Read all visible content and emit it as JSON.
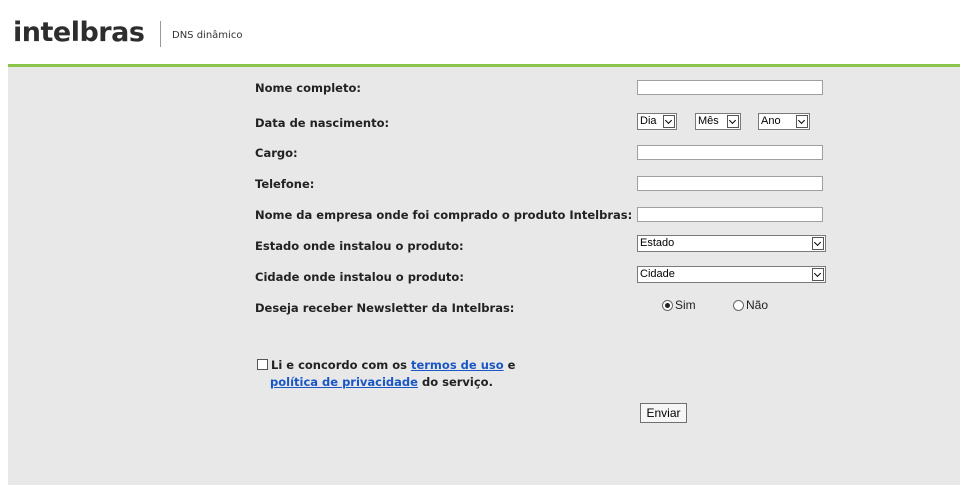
{
  "header": {
    "logo_text": "intelbras",
    "subtitle": "DNS dinâmico"
  },
  "form": {
    "full_name_label": "Nome completo:",
    "birth_date_label": "Data de nascimento:",
    "day_select": "Dia",
    "month_select": "Mês",
    "year_select": "Ano",
    "role_label": "Cargo:",
    "phone_label": "Telefone:",
    "company_label": "Nome da empresa onde foi comprado o produto Intelbras:",
    "state_label": "Estado onde instalou o produto:",
    "state_select": "Estado",
    "city_label": "Cidade onde instalou o produto:",
    "city_select": "Cidade",
    "newsletter_label": "Deseja receber Newsletter da Intelbras:",
    "newsletter_yes": "Sim",
    "newsletter_no": "Não",
    "newsletter_selected": "Sim"
  },
  "terms": {
    "text_before": "Li e concordo com os ",
    "terms_link": "termos de uso",
    "text_and": " e",
    "privacy_link": "política de privacidade",
    "text_after": " do serviço."
  },
  "submit_label": "Enviar",
  "colors": {
    "accent_green": "#8bc44a",
    "link_blue": "#1a57c6",
    "background": "#e8e8e8"
  }
}
